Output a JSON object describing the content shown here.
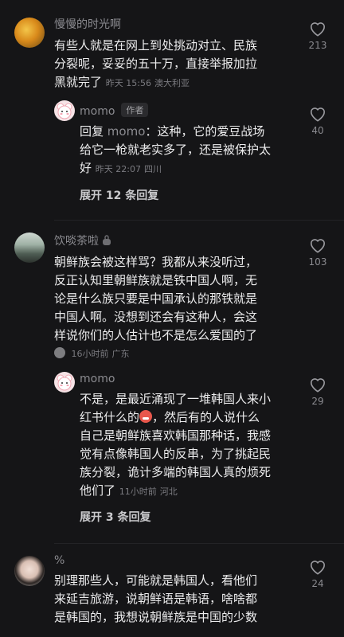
{
  "comments": [
    {
      "username": "慢慢的时光啊",
      "text_lines": [
        "有些人就是在网上到处挑动对立、民族",
        "分裂呢，妥妥的五十万，直接举报加拉",
        "黑就完了"
      ],
      "time": "昨天 15:56",
      "location": "澳大利亚",
      "likes": "213",
      "reply": {
        "username": "momo",
        "tag": "作者",
        "prefix": "回复",
        "reply_to": "momo",
        "text_lines": [
          "：这种，它的爱豆战场",
          "给它一枪就老实多了，还是被保护太",
          "好"
        ],
        "time": "昨天 22:07",
        "location": "四川",
        "likes": "40"
      },
      "expand": "展开 12 条回复"
    },
    {
      "username": "饮啖茶啦",
      "text_lines": [
        "朝鲜族会被这样骂？我都从来没听过，",
        "反正认知里朝鲜族就是铁中国人啊，无",
        "论是什么族只要是中国承认的那铁就是",
        "中国人啊。没想到还会有这种人，会这",
        "样说你们的人估计也不是怎么爱国的了"
      ],
      "time": "16小时前",
      "location": "广东",
      "likes": "103",
      "reply": {
        "username": "momo",
        "text_line1a": "不是，是最近涌现了一堆韩国人来小",
        "text_line2a": "红书什么的",
        "text_line2b": "，然后有的人说什么",
        "text_lines": [
          "自己是朝鲜族喜欢韩国那种话，我感",
          "觉有点像韩国人的反串，为了挑起民",
          "族分裂，诡计多端的韩国人真的烦死",
          "他们了"
        ],
        "time": "11小时前",
        "location": "河北",
        "likes": "29"
      },
      "expand": "展开 3 条回复"
    },
    {
      "username": "%",
      "text_lines": [
        "别理那些人，可能就是韩国人，看他们",
        "来延吉旅游，说朝鲜语是韩语，啥啥都",
        "是韩国的，我想说朝鲜族是中国的少数"
      ],
      "likes": "24"
    }
  ],
  "colors": {
    "background": "#151517",
    "text": "#ececed",
    "muted": "#8b8b90"
  },
  "icons": {
    "like": "heart-outline-icon"
  }
}
